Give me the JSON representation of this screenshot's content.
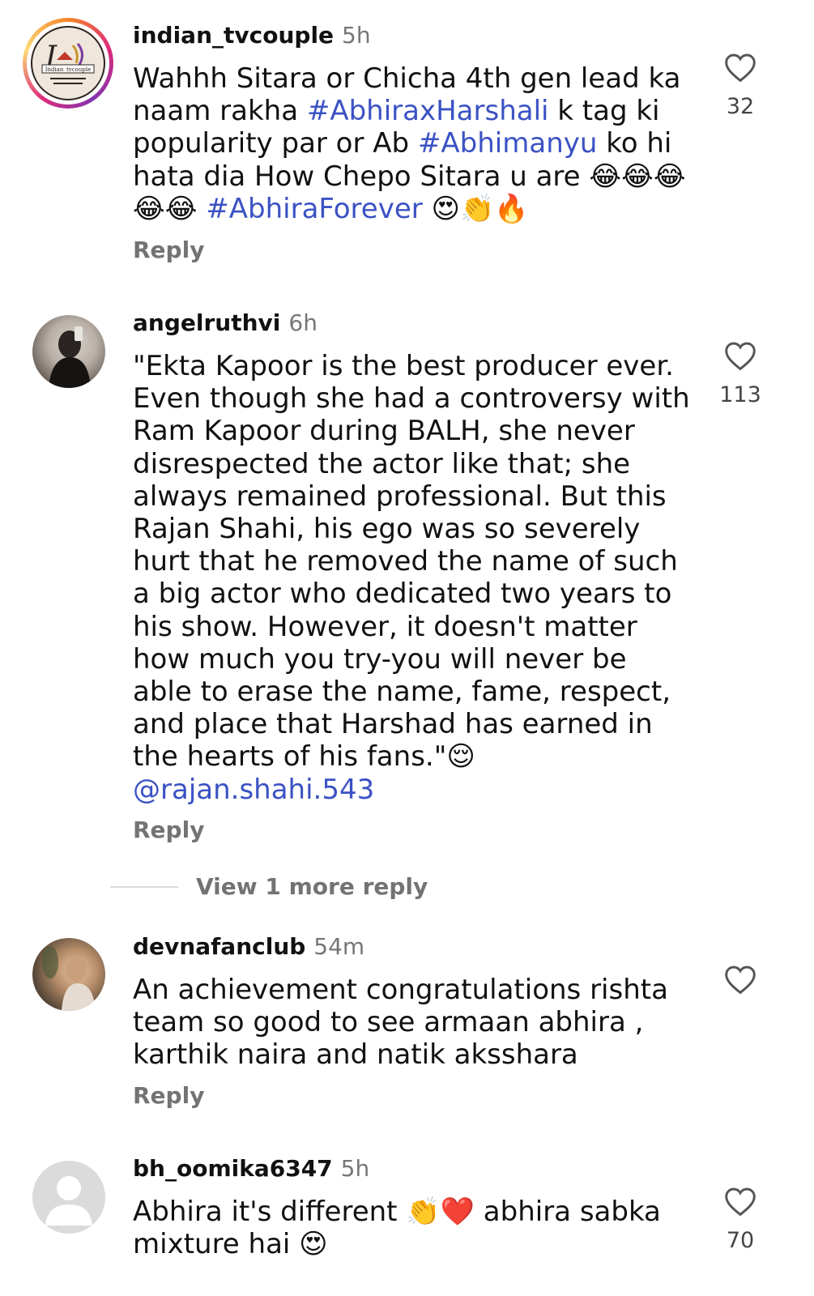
{
  "comments": [
    {
      "username": "indian_tvcouple",
      "time": "5h",
      "avatar_logo_text": "Indian_tvcouple",
      "text_parts": [
        {
          "t": "Wahhh Sitara or Chicha 4th gen lead ka naam rakha "
        },
        {
          "t": "#AbhiraxHarshali",
          "tag": true
        },
        {
          "t": " k tag ki popularity par or Ab "
        },
        {
          "t": "#Abhimanyu",
          "tag": true
        },
        {
          "t": " ko hi hata dia How Chepo Sitara u are 😂😂😂 😂😂 "
        },
        {
          "t": "#AbhiraForever",
          "tag": true
        },
        {
          "t": " 😍👏🔥"
        }
      ],
      "reply_label": "Reply",
      "likes": "32"
    },
    {
      "username": "angelruthvi",
      "time": "6h",
      "text_parts": [
        {
          "t": "\"Ekta Kapoor is the best producer ever. Even though she had a controversy with Ram Kapoor during BALH, she never disrespected the actor like that; she always remained professional. But this Rajan Shahi, his ego was so severely hurt that he removed the name of such a big actor who dedicated two years to his show. However, it doesn't matter how much you try-you will never be able to erase the name, fame, respect, and place that Harshad has earned in the hearts of his fans.\"😌"
        },
        {
          "t": "@rajan.shahi.543",
          "tag": true,
          "block": true
        }
      ],
      "reply_label": "Reply",
      "likes": "113"
    },
    {
      "username": "devnafanclub",
      "time": "54m",
      "text_parts": [
        {
          "t": "An achievement congratulations rishta team so good to see armaan abhira , karthik naira and natik aksshara"
        }
      ],
      "reply_label": "Reply",
      "likes": ""
    },
    {
      "username": "bh_oomika6347",
      "time": "5h",
      "text_parts": [
        {
          "t": "Abhira it's different 👏❤️ abhira sabka mixture hai 😍"
        }
      ],
      "reply_label": "Reply",
      "likes": "70"
    }
  ],
  "more_replies_label": "View 1 more reply",
  "icons": {
    "like": "heart-outline-icon",
    "default_avatar": "person-placeholder-icon"
  },
  "colors": {
    "hashtag": "#3b52c4",
    "secondary_text": "#737373"
  }
}
